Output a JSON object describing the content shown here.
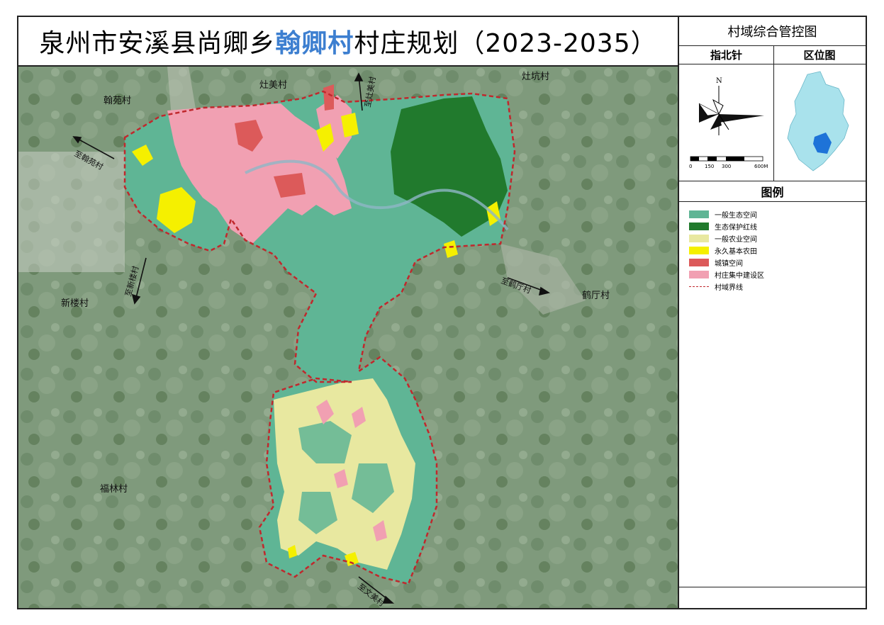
{
  "title": {
    "prefix": "泉州市安溪县尚卿乡",
    "highlight": "翰卿村",
    "suffix": "村庄规划（2023-2035）"
  },
  "panel": {
    "title": "村域综合管控图",
    "north_header": "指北针",
    "locator_header": "区位图",
    "legend_header": "图例"
  },
  "north_arrow": {
    "letter": "N"
  },
  "scale_bar": {
    "labels": [
      "0",
      "150",
      "300",
      "600M"
    ]
  },
  "legend": [
    {
      "label": "一般生态空间",
      "color": "#5fb595"
    },
    {
      "label": "生态保护红线",
      "color": "#217a2d"
    },
    {
      "label": "一般农业空间",
      "color": "#e8e8a0"
    },
    {
      "label": "永久基本农田",
      "color": "#f5f000"
    },
    {
      "label": "城镇空间",
      "color": "#dc5a5a"
    },
    {
      "label": "村庄集中建设区",
      "color": "#f1a0b2"
    },
    {
      "label": "村域界线",
      "color": "#c0282d",
      "style": "dashed"
    }
  ],
  "map_labels": {
    "hanyuan": "翰苑村",
    "zaomei": "灶美村",
    "zaokeng": "灶坑村",
    "xinlou": "新楼村",
    "heting": "鹤厅村",
    "fulin": "福林村",
    "to_hanyuan": "至翰苑村",
    "to_zaomei": "至灶美村",
    "to_xinlou": "至新楼村",
    "to_heting": "至鹤厅村",
    "to_wenmei": "至文美村"
  }
}
